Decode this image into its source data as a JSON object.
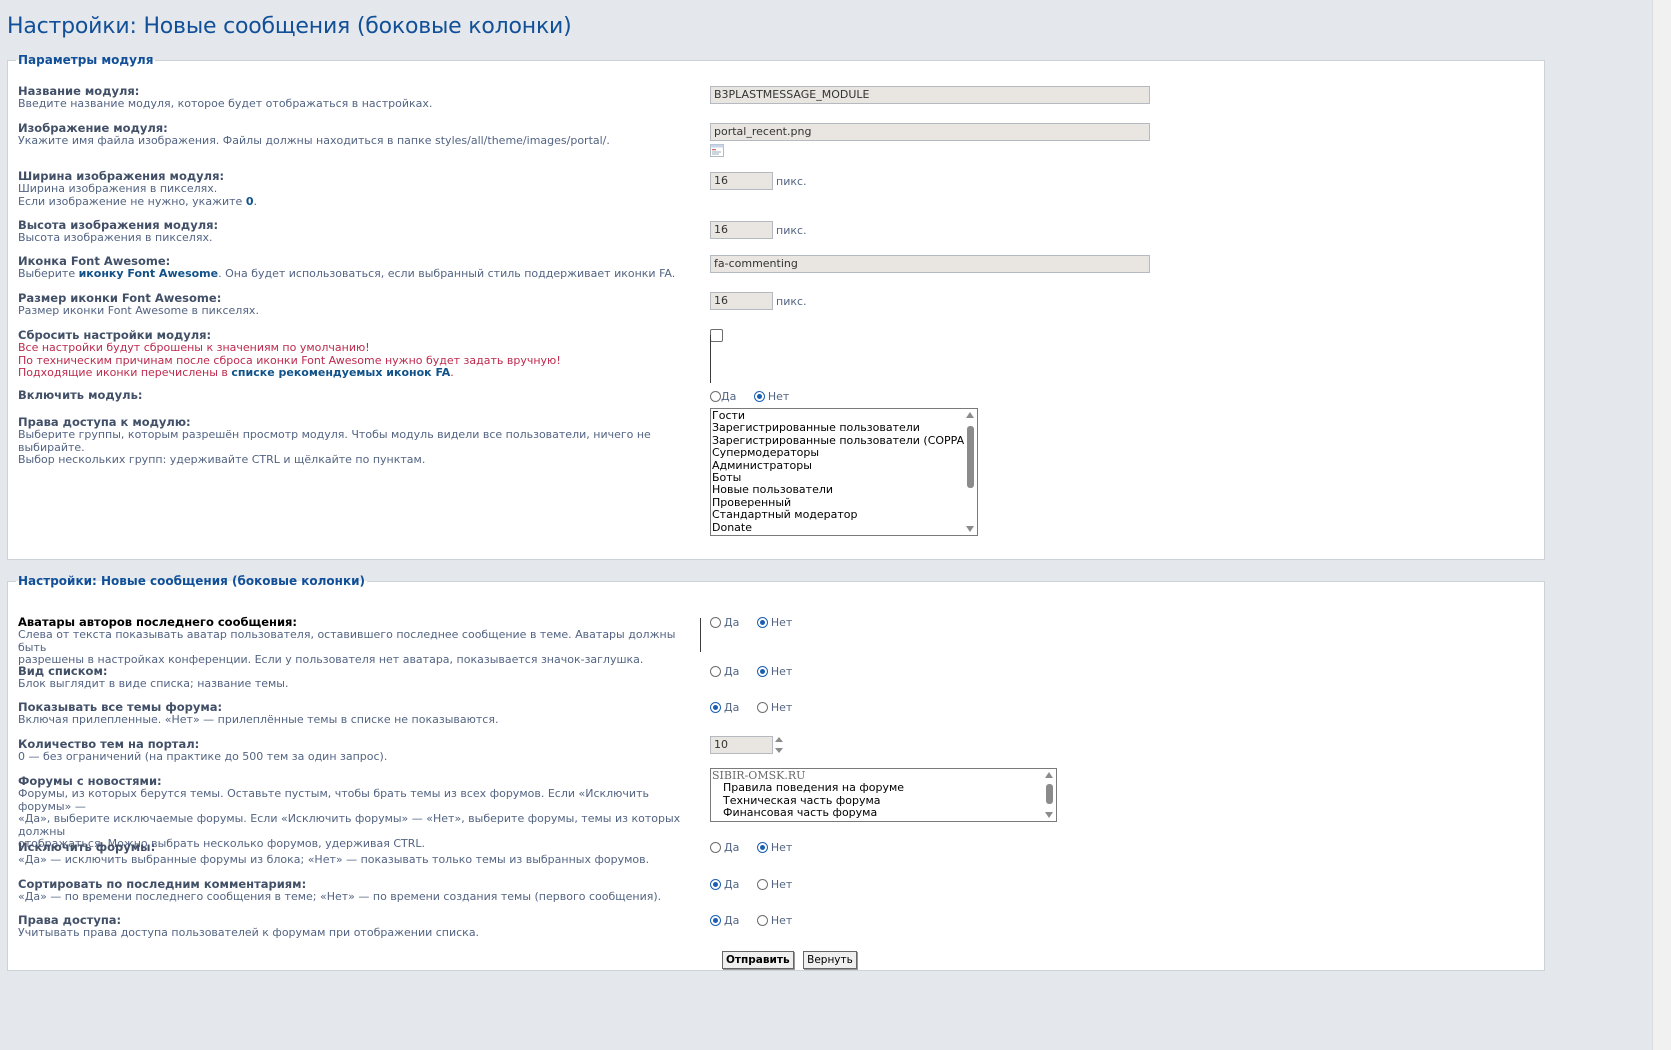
{
  "page": {
    "title": "Настройки: Новые сообщения (боковые колонки)"
  },
  "module_params": {
    "legend": "Параметры модуля",
    "name": {
      "label": "Название модуля:",
      "desc": "Введите название модуля, которое будет отображаться в настройках.",
      "value": "B3PLASTMESSAGE_MODULE"
    },
    "image": {
      "label": "Изображение модуля:",
      "desc": "Укажите имя файла изображения. Файлы должны находиться в папке styles/all/theme/images/portal/.",
      "value": "portal_recent.png"
    },
    "image_width": {
      "label": "Ширина изображения модуля:",
      "desc1": "Ширина изображения в пикселях.",
      "desc2_pre": "Если изображение не нужно, укажите ",
      "desc2_bold": "0",
      "desc2_post": ".",
      "value": "16",
      "unit": "пикс."
    },
    "image_height": {
      "label": "Высота изображения модуля:",
      "desc": "Высота изображения в пикселях.",
      "value": "16",
      "unit": "пикс."
    },
    "fa_icon": {
      "label": "Иконка Font Awesome:",
      "desc_pre": "Выберите ",
      "desc_link": "иконку Font Awesome",
      "desc_post": ". Она будет использоваться, если выбранный стиль поддерживает иконки FA.",
      "value": "fa-commenting"
    },
    "fa_size": {
      "label": "Размер иконки Font Awesome:",
      "desc": "Размер иконки Font Awesome в пикселях.",
      "value": "16",
      "unit": "пикс."
    },
    "reset": {
      "label": "Сбросить настройки модуля:",
      "warn1": "Все настройки будут сброшены к значениям по умолчанию!",
      "warn2": "По техническим причинам после сброса иконки Font Awesome нужно будет задать вручную!",
      "warn3_pre": "Подходящие иконки перечислены в ",
      "warn3_link": "списке рекомендуемых иконок FA",
      "warn3_post": ".",
      "checked": false
    },
    "enable": {
      "label": "Включить модуль:",
      "yes": "Да",
      "no": "Нет",
      "selected": "no"
    },
    "access": {
      "label": "Права доступа к модулю:",
      "desc1": "Выберите группы, которым разрешён просмотр модуля. Чтобы модуль видели все пользователи, ничего не выбирайте.",
      "desc2": "Выбор нескольких групп: удерживайте CTRL и щёлкайте по пунктам.",
      "options": [
        "Гости",
        "Зарегистрированные пользователи",
        "Зарегистрированные пользователи (COPPA)",
        "Супермодераторы",
        "Администраторы",
        "Боты",
        "Новые пользователи",
        "Проверенный",
        "Стандартный модератор",
        "Donate"
      ]
    }
  },
  "recent_settings": {
    "legend": "Настройки: Новые сообщения (боковые колонки)",
    "yes": "Да",
    "no": "Нет",
    "avatars": {
      "label": "Аватары авторов последнего сообщения:",
      "desc1": "Слева от текста показывать аватар пользователя, оставившего последнее сообщение в теме. Аватары должны быть",
      "desc2": "разрешены в настройках конференции. Если у пользователя нет аватара, показывается значок-заглушка.",
      "selected": "no"
    },
    "list_view": {
      "label": "Вид списком:",
      "desc": "Блок выглядит в виде списка; название темы.",
      "selected": "no"
    },
    "all_topics": {
      "label": "Показывать все темы форума:",
      "desc": "Включая прилепленные. «Нет» — прилеплённые темы в списке не показываются.",
      "selected": "yes"
    },
    "topic_count": {
      "label": "Количество тем на портал:",
      "desc": "0 — без ограничений (на практике до 500 тем за один запрос).",
      "value": "10"
    },
    "news_forums": {
      "label": "Форумы с новостями:",
      "desc1": "Форумы, из которых берутся темы. Оставьте пустым, чтобы брать темы из всех форумов. Если «Исключить форумы» —",
      "desc2": "«Да», выберите исключаемые форумы. Если «Исключить форумы» — «Нет», выберите форумы, темы из которых должны",
      "desc3": "отображаться. Можно выбрать несколько форумов, удерживая CTRL.",
      "options": [
        "SIBIR-OMSK.RU",
        "Правила поведения на форуме",
        "Техническая часть форума",
        "Финансовая часть форума"
      ]
    },
    "exclude_forums": {
      "label": "Исключить форумы:",
      "desc": "«Да» — исключить выбранные форумы из блока; «Нет» — показывать только темы из выбранных форумов.",
      "selected": "no"
    },
    "sort_last": {
      "label": "Сортировать по последним комментариям:",
      "desc": "«Да» — по времени последнего сообщения в теме; «Нет» — по времени создания темы (первого сообщения).",
      "selected": "yes"
    },
    "permissions": {
      "label": "Права доступа:",
      "desc": "Учитывать права доступа пользователей к форумам при отображении списка.",
      "selected": "yes"
    }
  },
  "buttons": {
    "submit": "Отправить",
    "reset": "Вернуть"
  }
}
